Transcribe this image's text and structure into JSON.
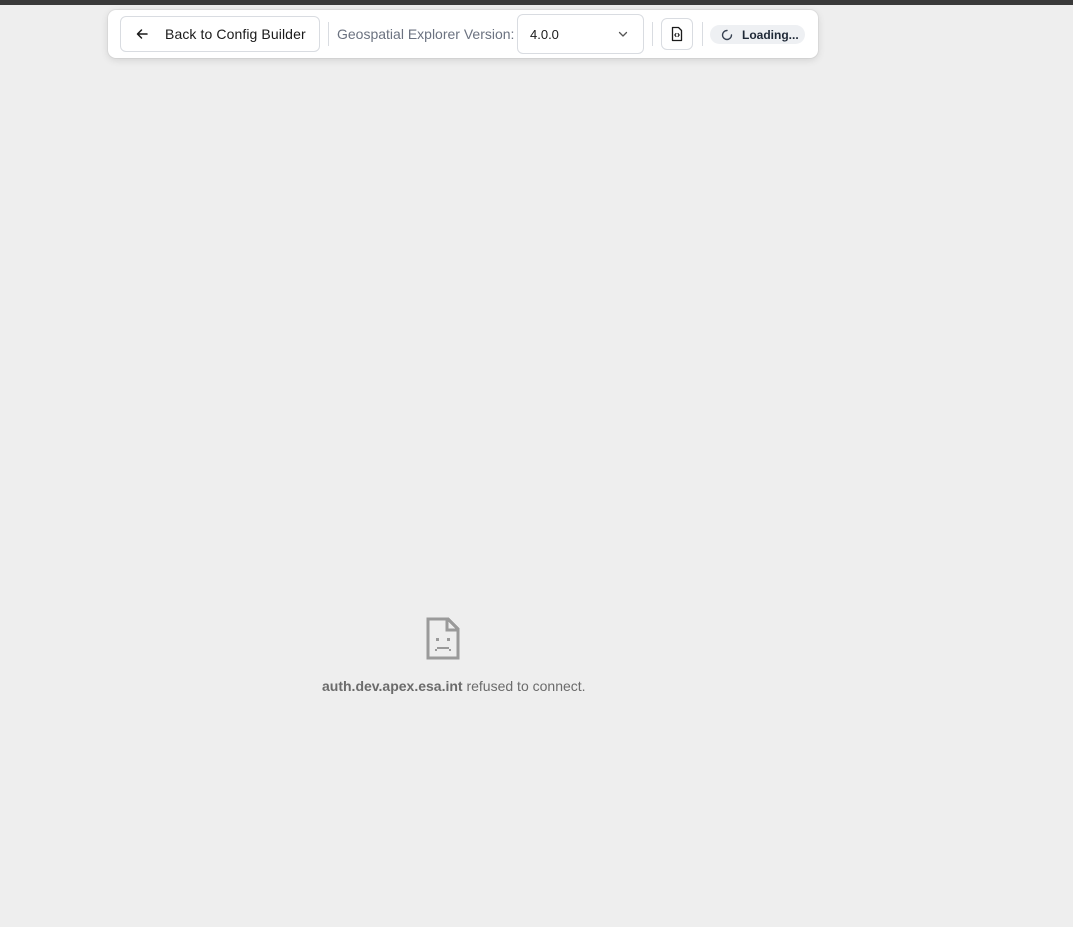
{
  "toolbar": {
    "back_label": "Back to Config Builder",
    "version_label": "Geospatial Explorer Version:",
    "version_value": "4.0.0",
    "status_text": "Loading...",
    "icons": {
      "back": "arrow-left-icon",
      "dropdown": "chevron-down-icon",
      "code": "file-code-icon",
      "spinner": "loading-spinner-icon"
    }
  },
  "error": {
    "host": "auth.dev.apex.esa.int",
    "message": "refused to connect.",
    "icon": "sad-document-icon"
  },
  "colors": {
    "background": "#eeeeee",
    "toolbar": "#ffffff",
    "pill": "#eef0f3",
    "error_text": "#6b6b6b"
  }
}
